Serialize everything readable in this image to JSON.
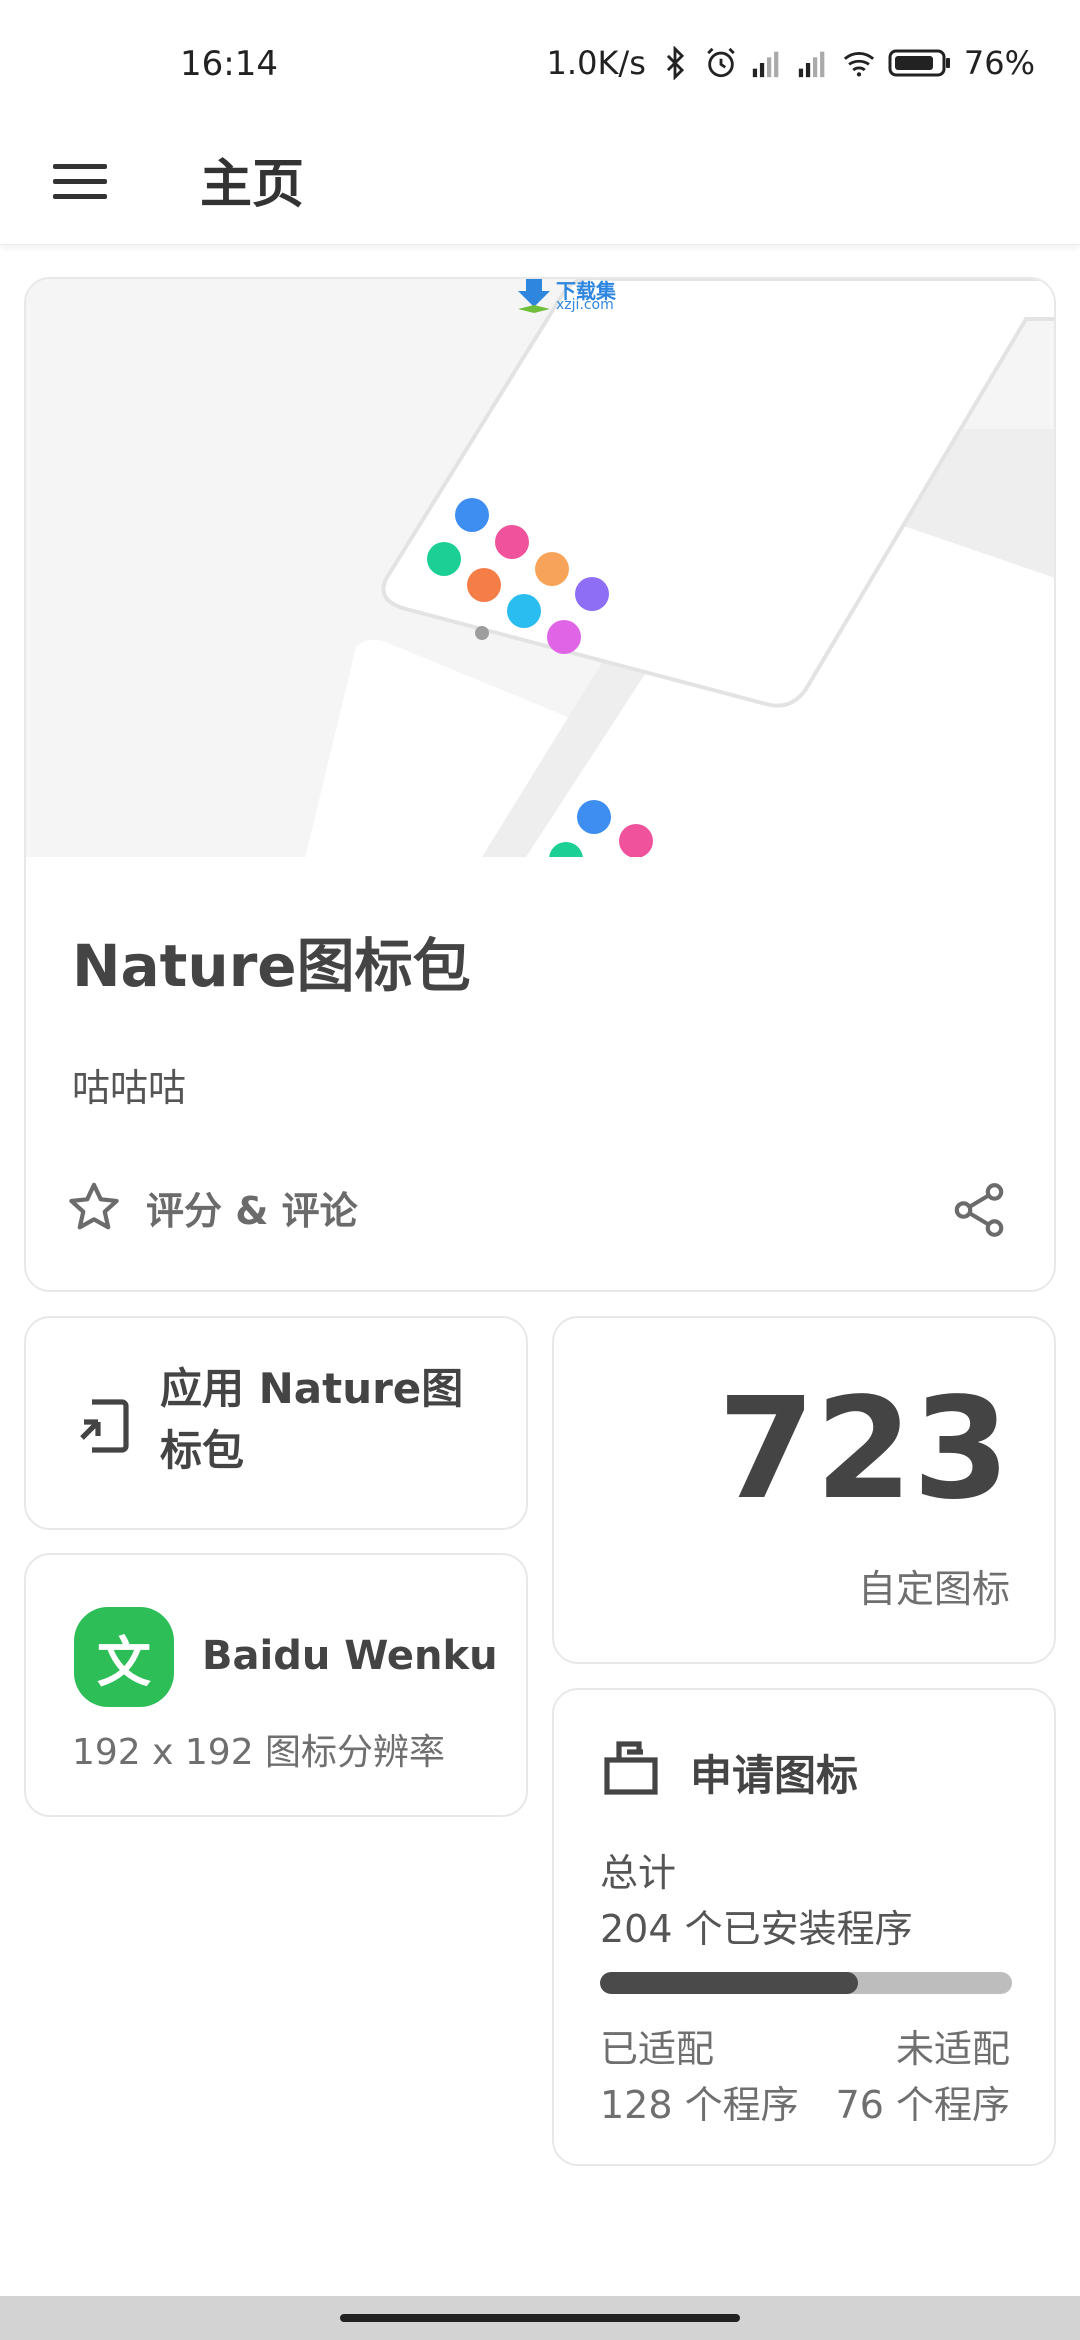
{
  "status_bar": {
    "time": "16:14",
    "network_speed": "1.0K/s",
    "battery_percent": "76%",
    "icons": [
      "bluetooth-icon",
      "alarm-icon",
      "signal-hd-icon",
      "signal-icon",
      "wifi-icon",
      "battery-icon"
    ]
  },
  "app_bar": {
    "title": "主页",
    "menu_icon": "hamburger-menu-icon"
  },
  "hero": {
    "watermark_top": "下载集",
    "watermark_bottom": "xzji.com",
    "title": "Nature图标包",
    "subtitle": "咕咕咕",
    "rate_label": "评分 & 评论",
    "rate_icon": "star-outline-icon",
    "share_icon": "share-icon"
  },
  "apply": {
    "label": "应用 Nature图标包",
    "icon": "apply-launcher-icon"
  },
  "wenku": {
    "icon_glyph": "文",
    "name": "Baidu Wenku",
    "resolution": "192 x 192 图标分辨率",
    "brand_color": "#2dbe57"
  },
  "custom_icons": {
    "count": "723",
    "label": "自定图标"
  },
  "request": {
    "title": "申请图标",
    "icon": "request-icon",
    "total_label": "总计",
    "total_value": "204 个已安装程序",
    "adapted_label": "已适配",
    "adapted_value": "128 个程序",
    "unadapted_label": "未适配",
    "unadapted_value": "76 个程序",
    "adapted_fraction": 0.627
  },
  "colors": {
    "progress_fill": "#4a4a4a",
    "progress_track": "#bdbdbd",
    "accent_text": "#444444"
  }
}
